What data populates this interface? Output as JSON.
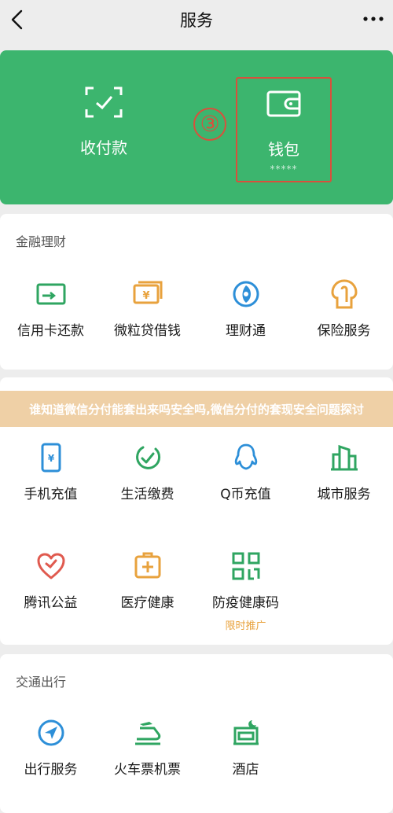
{
  "header": {
    "title": "服务",
    "back_icon": "chevron-left-icon",
    "more_icon": "more-dots-icon"
  },
  "pay_panel": {
    "background": "#3cb56e",
    "collect": {
      "label": "收付款",
      "icon": "qr-scan-icon"
    },
    "wallet": {
      "label": "钱包",
      "balance_mask": "*****",
      "icon": "wallet-icon",
      "highlight_color": "#d9503c"
    },
    "step_marker": "③"
  },
  "finance": {
    "title": "金融理财",
    "items": [
      {
        "label": "信用卡还款",
        "icon": "credit-card-icon"
      },
      {
        "label": "微粒贷借钱",
        "icon": "cash-loan-icon"
      },
      {
        "label": "理财通",
        "icon": "wealth-icon"
      },
      {
        "label": "保险服务",
        "icon": "insurance-icon"
      }
    ]
  },
  "banner": {
    "text": "谁知道微信分付能套出来吗安全吗,微信分付的套现安全问题探讨"
  },
  "life": {
    "items": [
      {
        "label": "手机充值",
        "icon": "phone-recharge-icon"
      },
      {
        "label": "生活缴费",
        "icon": "utility-payment-icon"
      },
      {
        "label": "Q币充值",
        "icon": "qq-penguin-icon"
      },
      {
        "label": "城市服务",
        "icon": "city-buildings-icon"
      },
      {
        "label": "腾讯公益",
        "icon": "charity-heart-icon"
      },
      {
        "label": "医疗健康",
        "icon": "medical-kit-icon"
      },
      {
        "label": "防疫健康码",
        "icon": "health-qr-code-icon",
        "promo": "限时推广"
      }
    ]
  },
  "travel": {
    "title": "交通出行",
    "items": [
      {
        "label": "出行服务",
        "icon": "navigation-icon"
      },
      {
        "label": "火车票机票",
        "icon": "train-plane-icon"
      },
      {
        "label": "酒店",
        "icon": "hotel-bed-icon"
      }
    ]
  },
  "colors": {
    "accent_green": "#3cb56e",
    "icon_green": "#2fa561",
    "icon_orange": "#e8a23d",
    "icon_blue": "#2d8fd8",
    "icon_red": "#e05a4f"
  }
}
